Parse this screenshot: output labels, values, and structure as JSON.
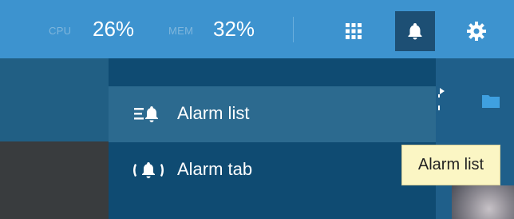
{
  "topbar": {
    "cpu_label": "CPU",
    "cpu_value": "26%",
    "mem_label": "MEM",
    "mem_value": "32%",
    "icons": [
      "grid-icon",
      "bell-icon",
      "gear-icon"
    ]
  },
  "alarm_menu": {
    "items": [
      {
        "label": "Alarm list",
        "icon": "alarm-list-icon",
        "state": "hover"
      },
      {
        "label": "Alarm tab",
        "icon": "alarm-tab-icon",
        "state": "normal"
      }
    ]
  },
  "tooltip": {
    "text": "Alarm list"
  },
  "colors": {
    "topbar": "#3d93cf",
    "active_button": "#1d4f74",
    "menu_bg": "#0f4b72",
    "menu_hover": "#2c6a8f",
    "tooltip_bg": "#fbf6c4"
  }
}
